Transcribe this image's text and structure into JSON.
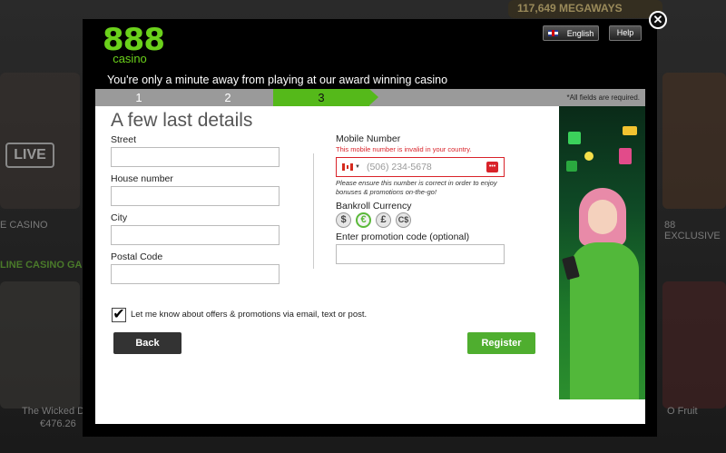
{
  "background": {
    "live_label": "LIVE",
    "casino_label": "E CASINO",
    "exclusive_label": "88 EXCLUSIVE",
    "section_label": "LINE CASINO GA",
    "megaways": "117,649 MEGAWAYS",
    "game_left_name": "The Wicked De",
    "game_left_value": "€476.26",
    "game_right_name": "O Fruit"
  },
  "header": {
    "logo_number": "888",
    "logo_word": "casino",
    "language": "English",
    "help": "Help",
    "close": "✕",
    "tagline": "You're only a minute away from playing at our award winning casino"
  },
  "steps": {
    "items": [
      "1",
      "2",
      "3"
    ],
    "active": 3,
    "required_note": "*All fields are required."
  },
  "form": {
    "heading": "A few last details",
    "street_label": "Street",
    "house_label": "House number",
    "city_label": "City",
    "postal_label": "Postal Code",
    "mobile_label": "Mobile Number",
    "mobile_error": "This mobile number is invalid in your country.",
    "mobile_placeholder": "(506) 234-5678",
    "mobile_hint": "Please ensure this number is correct in order to enjoy bonuses & promotions on-the-go!",
    "currency_label": "Bankroll Currency",
    "currencies": [
      "$",
      "€",
      "£",
      "C$"
    ],
    "currency_selected": "€",
    "promo_label": "Enter promotion code (optional)",
    "consent_checked": true,
    "consent_label": "Let me know about offers & promotions via email, text or post.",
    "back": "Back",
    "register": "Register"
  },
  "colors": {
    "brand_green": "#6bd11b",
    "register_green": "#4fae2f",
    "error_red": "#d9232a"
  }
}
